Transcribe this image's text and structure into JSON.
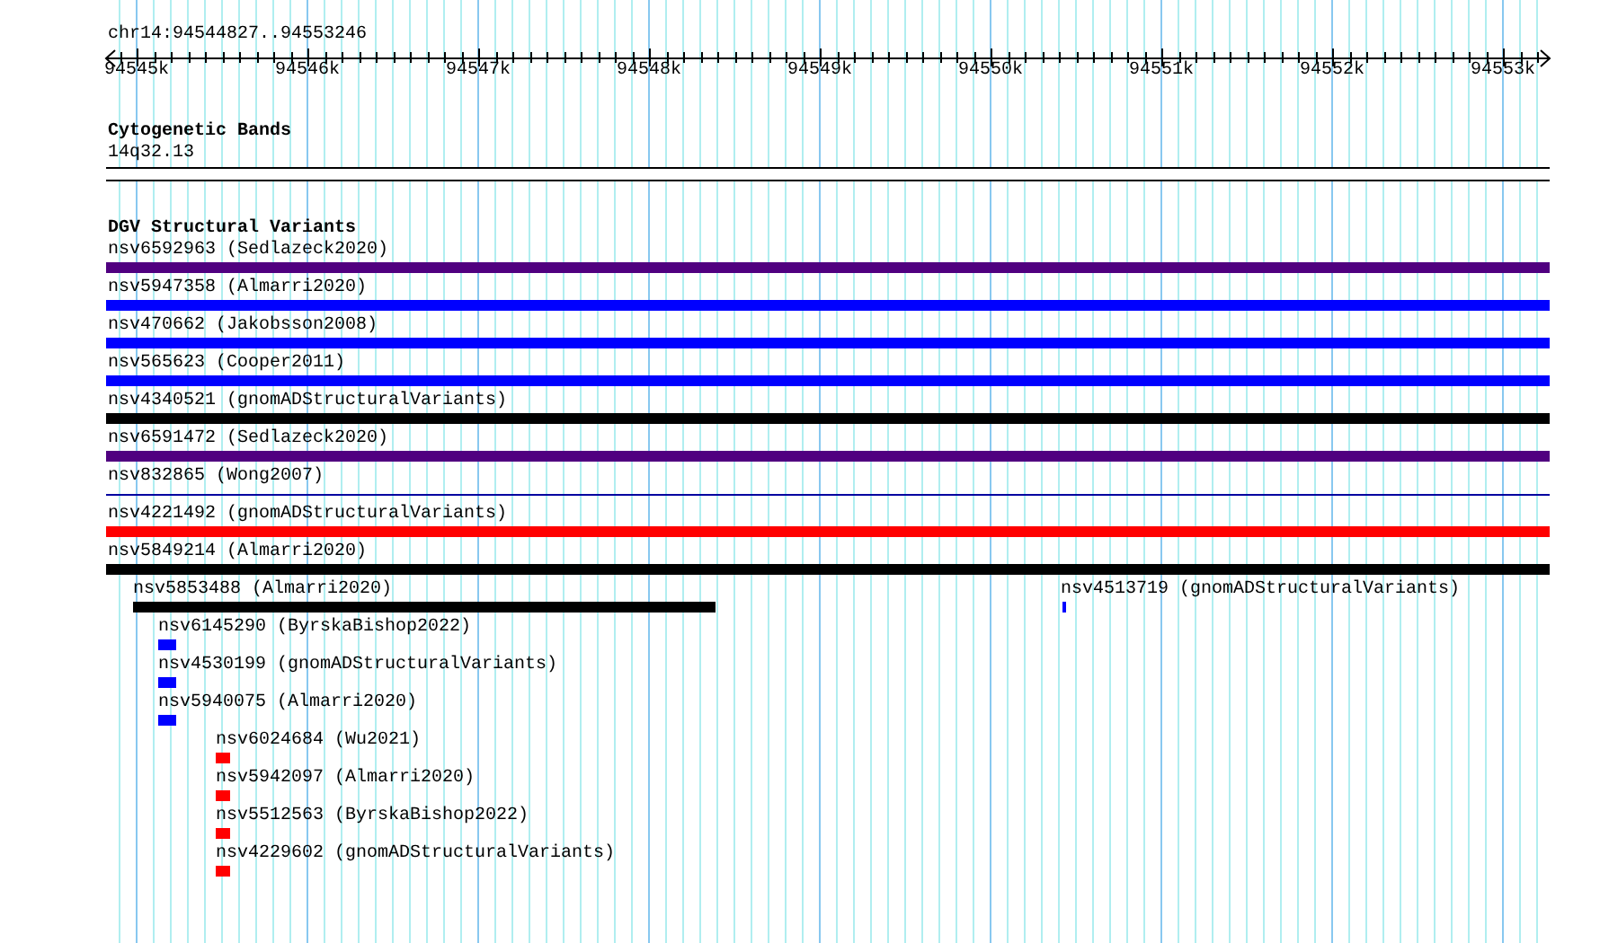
{
  "ruler": {
    "region": "chr14:94544827..94553246",
    "ticks": [
      "94545k",
      "94546k",
      "94547k",
      "94548k",
      "94549k",
      "94550k",
      "94551k",
      "94552k",
      "94553k"
    ]
  },
  "cytoband_track": {
    "title": "Cytogenetic Bands",
    "band": "14q32.13"
  },
  "variant_track": {
    "title": "DGV Structural Variants",
    "features": [
      {
        "label": "nsv6592963 (Sedlazeck2020)",
        "color": "#500080",
        "kind": "bar"
      },
      {
        "label": "nsv5947358 (Almarri2020)",
        "color": "#0000ff",
        "kind": "bar"
      },
      {
        "label": "nsv470662 (Jakobsson2008)",
        "color": "#0000ff",
        "kind": "bar"
      },
      {
        "label": "nsv565623 (Cooper2011)",
        "color": "#0000ff",
        "kind": "bar"
      },
      {
        "label": "nsv4340521 (gnomADStructuralVariants)",
        "color": "#000000",
        "kind": "bar"
      },
      {
        "label": "nsv6591472 (Sedlazeck2020)",
        "color": "#500080",
        "kind": "bar"
      },
      {
        "label": "nsv832865 (Wong2007)",
        "color": "#0000a0",
        "kind": "line"
      },
      {
        "label": "nsv4221492 (gnomADStructuralVariants)",
        "color": "#ff0000",
        "kind": "bar"
      },
      {
        "label": "nsv5849214 (Almarri2020)",
        "color": "#000000",
        "kind": "bar"
      },
      {
        "label": "nsv5853488 (Almarri2020)",
        "color": "#000000",
        "kind": "bar"
      },
      {
        "label": "nsv4513719 (gnomADStructuralVariants)",
        "color": "#0000ff",
        "kind": "bar"
      },
      {
        "label": "nsv6145290 (ByrskaBishop2022)",
        "color": "#0000ff",
        "kind": "bar"
      },
      {
        "label": "nsv4530199 (gnomADStructuralVariants)",
        "color": "#0000ff",
        "kind": "bar"
      },
      {
        "label": "nsv5940075 (Almarri2020)",
        "color": "#0000ff",
        "kind": "bar"
      },
      {
        "label": "nsv6024684 (Wu2021)",
        "color": "#ff0000",
        "kind": "bar"
      },
      {
        "label": "nsv5942097 (Almarri2020)",
        "color": "#ff0000",
        "kind": "bar"
      },
      {
        "label": "nsv5512563 (ByrskaBishop2022)",
        "color": "#ff0000",
        "kind": "bar"
      },
      {
        "label": "nsv4229602 (gnomADStructuralVariants)",
        "color": "#ff0000",
        "kind": "bar"
      }
    ]
  }
}
